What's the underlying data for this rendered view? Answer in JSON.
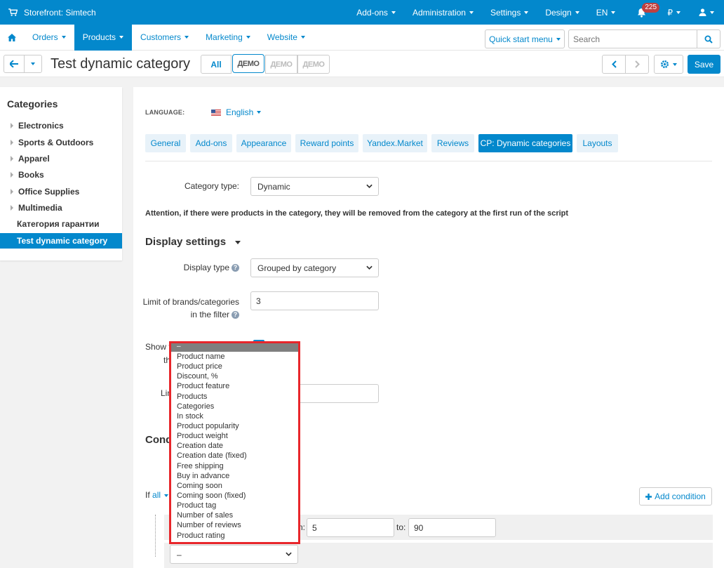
{
  "topbar": {
    "store_title": "Storefront: Simtech",
    "menus": [
      "Add-ons",
      "Administration",
      "Settings",
      "Design",
      "EN"
    ],
    "notifications": "225",
    "currency": "₽"
  },
  "nav": {
    "items": [
      "Orders",
      "Products",
      "Customers",
      "Marketing",
      "Website"
    ],
    "active": "Products",
    "quick_start": "Quick start menu",
    "search_placeholder": "Search"
  },
  "header": {
    "title": "Test dynamic category",
    "all_label": "All",
    "demo_labels": [
      "ДЕМО",
      "ДЕМО",
      "ДЕМО"
    ],
    "save_label": "Save"
  },
  "sidebar": {
    "title": "Categories",
    "items": [
      {
        "label": "Electronics",
        "expandable": true
      },
      {
        "label": "Sports & Outdoors",
        "expandable": true
      },
      {
        "label": "Apparel",
        "expandable": true
      },
      {
        "label": "Books",
        "expandable": true
      },
      {
        "label": "Office Supplies",
        "expandable": true
      },
      {
        "label": "Multimedia",
        "expandable": true
      },
      {
        "label": "Категория гарантии",
        "expandable": false
      },
      {
        "label": "Test dynamic category",
        "expandable": false,
        "active": true
      }
    ]
  },
  "language": {
    "label": "LANGUAGE:",
    "value": "English"
  },
  "tabs": [
    "General",
    "Add-ons",
    "Appearance",
    "Reward points",
    "Yandex.Market",
    "Reviews",
    "CP: Dynamic categories",
    "Layouts"
  ],
  "active_tab": "CP: Dynamic categories",
  "form": {
    "category_type_label": "Category type:",
    "category_type_value": "Dynamic",
    "attention": "Attention, if there were products in the category, they will be removed from the category at the first run of the script",
    "display_settings": "Display settings",
    "display_type_label": "Display type",
    "display_type_value": "Grouped by category",
    "limit_label_1": "Limit of brands/categories",
    "limit_label_2": "in the filter",
    "limit_value": "3",
    "show_label_partial": "Show t",
    "show_label_partial2": "th",
    "limit2_label_partial": "Lin",
    "conditions_partial": "Cond",
    "if_label": "If",
    "if_value": "all",
    "add_condition": "Add condition",
    "from_partial": "n:",
    "from_value": "5",
    "to_label": "to:",
    "to_value": "90",
    "new_condition_value": "–"
  },
  "dropdown": {
    "selected": "–",
    "options": [
      "Product name",
      "Product price",
      "Discount, %",
      "Product feature",
      "Products",
      "Categories",
      "In stock",
      "Product popularity",
      "Product weight",
      "Creation date",
      "Creation date (fixed)",
      "Free shipping",
      "Buy in advance",
      "Coming soon",
      "Coming soon (fixed)",
      "Product tag",
      "Number of sales",
      "Number of reviews",
      "Product rating"
    ]
  },
  "colors": {
    "accent": "#0388cc",
    "highlight": "#e8262b",
    "badge": "#bf4040"
  }
}
